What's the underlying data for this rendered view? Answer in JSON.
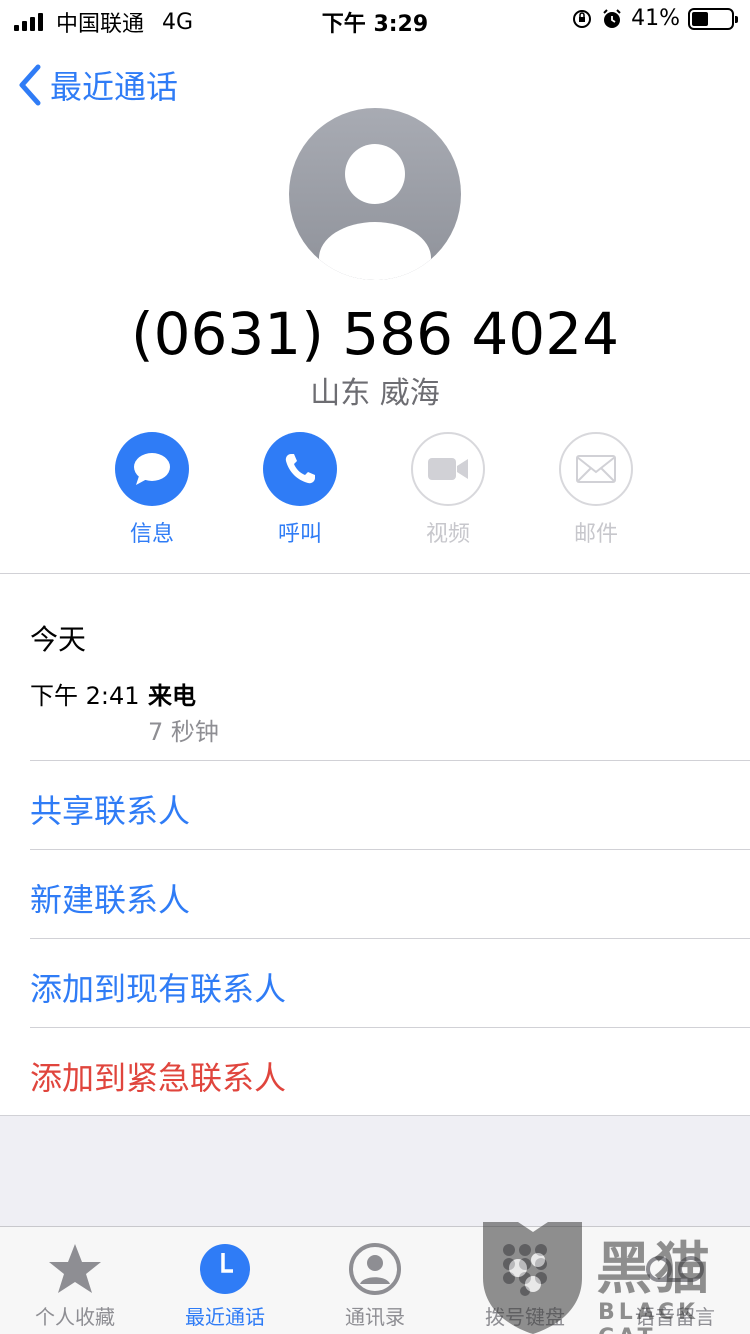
{
  "status_bar": {
    "carrier": "中国联通",
    "network": "4G",
    "time": "下午 3:29",
    "battery_percent": "41%",
    "battery_level": 0.41
  },
  "nav": {
    "back_label": "最近通话"
  },
  "contact": {
    "phone_number": "(0631) 586 4024",
    "location": "山东 威海"
  },
  "actions": [
    {
      "label": "信息",
      "icon": "message-icon",
      "enabled": true
    },
    {
      "label": "呼叫",
      "icon": "phone-icon",
      "enabled": true
    },
    {
      "label": "视频",
      "icon": "video-icon",
      "enabled": false
    },
    {
      "label": "邮件",
      "icon": "mail-icon",
      "enabled": false
    }
  ],
  "call_history": {
    "section_title": "今天",
    "entries": [
      {
        "time": "下午 2:41",
        "type": "来电",
        "duration": "7 秒钟"
      }
    ]
  },
  "menu": {
    "share_contact": "共享联系人",
    "new_contact": "新建联系人",
    "add_to_existing": "添加到现有联系人",
    "add_to_emergency": "添加到紧急联系人"
  },
  "tab_bar": {
    "tabs": [
      {
        "label": "个人收藏",
        "icon": "star-icon",
        "selected": false
      },
      {
        "label": "最近通话",
        "icon": "clock-icon",
        "selected": true
      },
      {
        "label": "通讯录",
        "icon": "contacts-icon",
        "selected": false
      },
      {
        "label": "拨号键盘",
        "icon": "keypad-icon",
        "selected": false
      },
      {
        "label": "语音留言",
        "icon": "voicemail-icon",
        "selected": false
      }
    ]
  },
  "watermark": {
    "title": "黑猫",
    "subtitle": "BLACK CAT"
  },
  "colors": {
    "accent": "#2f7cf6",
    "destructive": "#e0453d",
    "secondary_text": "#8e8e93"
  }
}
